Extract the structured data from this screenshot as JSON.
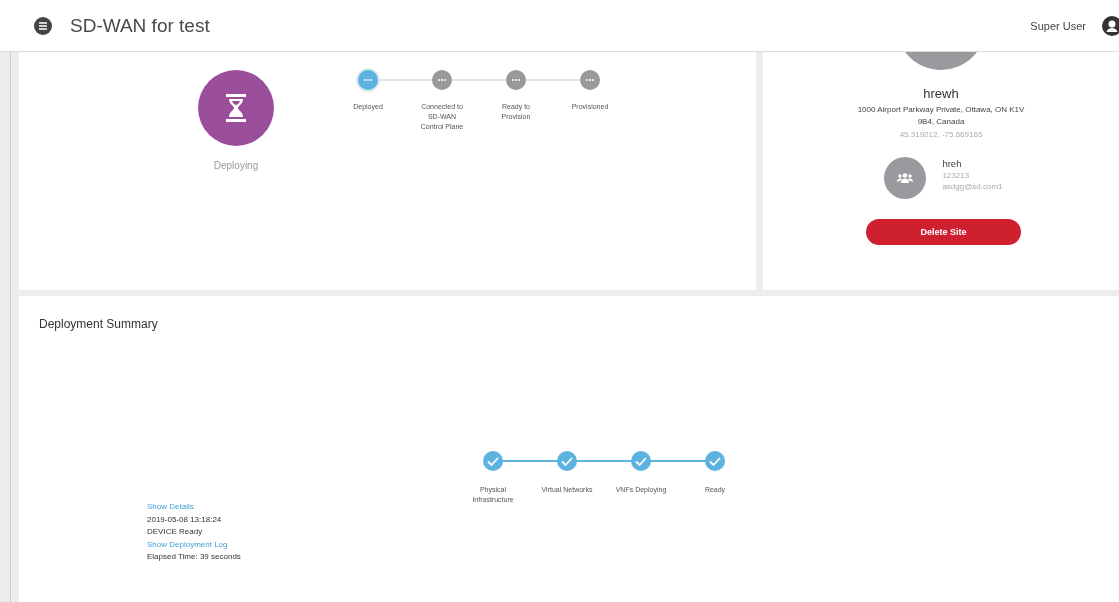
{
  "header": {
    "title": "SD-WAN for test",
    "user": "Super User"
  },
  "site_status": {
    "status": "Deploying",
    "steps": [
      {
        "label": "Deployed",
        "kind": "active"
      },
      {
        "label": "Connected to SD-WAN Control Plane",
        "kind": "pending"
      },
      {
        "label": "Ready to Provision",
        "kind": "pending"
      },
      {
        "label": "Provisioned",
        "kind": "pending"
      }
    ]
  },
  "site_info": {
    "name": "hrewh",
    "address": "1000 Airport Parkway Private, Ottawa, ON K1V 9B4, Canada",
    "coordinates": "45.319212, -75.669165",
    "contact": {
      "name": "hreh",
      "phone": "123213",
      "email": "asdgg@sd.com1"
    },
    "delete_button": "Delete Site"
  },
  "deployment_summary": {
    "title": "Deployment Summary",
    "steps": [
      {
        "label": "Physical Infrastructure",
        "kind": "complete"
      },
      {
        "label": "Virtual Networks",
        "kind": "complete"
      },
      {
        "label": "VNFs Deploying",
        "kind": "complete"
      },
      {
        "label": "Ready",
        "kind": "complete"
      }
    ],
    "log": [
      {
        "kind": "link",
        "text": "Show Details"
      },
      {
        "kind": "text",
        "text": "2019-05-08 13:18:24"
      },
      {
        "kind": "text",
        "text": "DEVICE Ready"
      },
      {
        "kind": "link",
        "text": "Show Deployment Log"
      },
      {
        "kind": "text",
        "text": "Elapsed Time: 39 seconds"
      }
    ]
  }
}
